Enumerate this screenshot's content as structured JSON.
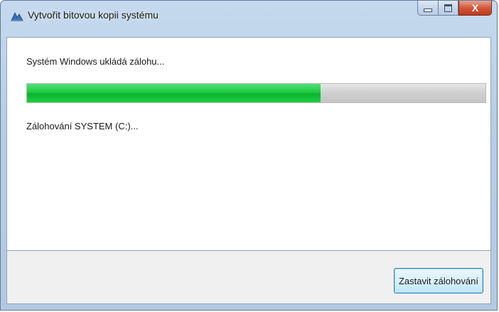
{
  "window": {
    "title": "Vytvořit bitovou kopii systému",
    "icon": "backup-app-icon"
  },
  "caption_buttons": {
    "minimize_icon": "minimize-icon",
    "maximize_icon": "maximize-icon",
    "close_label": "X"
  },
  "main": {
    "status": "Systém Windows ukládá zálohu...",
    "progress_fraction": 0.64,
    "detail": "Zálohování SYSTEM (C:)..."
  },
  "footer": {
    "stop_button_label": "Zastavit zálohování"
  },
  "colors": {
    "progress_fill": "#1fcc3f",
    "progress_track": "#cfcfcf",
    "close_button": "#c0391b"
  }
}
